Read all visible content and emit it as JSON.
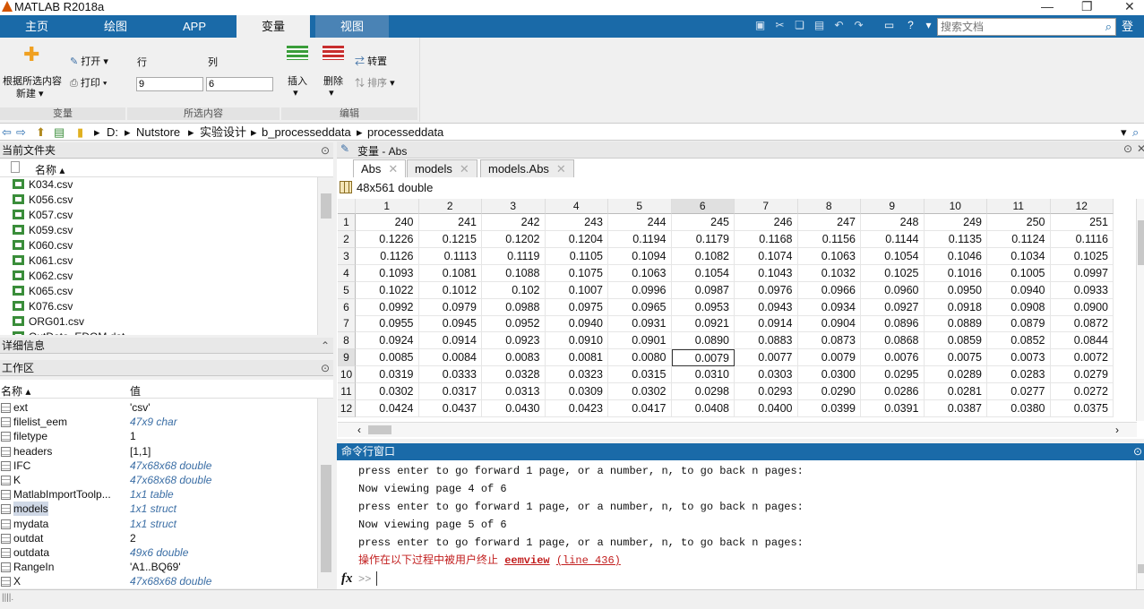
{
  "window": {
    "title": "MATLAB R2018a"
  },
  "tabs": [
    "主页",
    "绘图",
    "APP",
    "变量",
    "视图"
  ],
  "search": {
    "placeholder": "搜索文档"
  },
  "login_label": "登录",
  "ribbon": {
    "new_from_selection": "根据所选内容",
    "new_label": "新建",
    "open_label": "打开",
    "print_label": "打印",
    "rows_label": "行",
    "cols_label": "列",
    "rows_value": "9",
    "cols_value": "6",
    "insert_label": "插入",
    "delete_label": "删除",
    "transpose_label": "转置",
    "sort_label": "排序",
    "section_variable": "变量",
    "section_selection": "所选内容",
    "section_edit": "编辑"
  },
  "address": {
    "segments": [
      "D:",
      "Nutstore",
      "实验设计",
      "b_processeddata",
      "processeddata"
    ]
  },
  "current_folder": {
    "title": "当前文件夹",
    "col_name": "名称",
    "files": [
      "K034.csv",
      "K056.csv",
      "K057.csv",
      "K059.csv",
      "K060.csv",
      "K061.csv",
      "K062.csv",
      "K065.csv",
      "K076.csv",
      "ORG01.csv",
      "OutData_EDOM.dat"
    ]
  },
  "details": {
    "title": "详细信息"
  },
  "workspace": {
    "title": "工作区",
    "col_name": "名称",
    "col_value": "值",
    "vars": [
      {
        "name": "ext",
        "value": "'csv'",
        "italic": false
      },
      {
        "name": "filelist_eem",
        "value": "47x9 char",
        "italic": true
      },
      {
        "name": "filetype",
        "value": "1",
        "italic": false
      },
      {
        "name": "headers",
        "value": "[1,1]",
        "italic": false
      },
      {
        "name": "IFC",
        "value": "47x68x68 double",
        "italic": true
      },
      {
        "name": "K",
        "value": "47x68x68 double",
        "italic": true
      },
      {
        "name": "MatlabImportToolp...",
        "value": "1x1 table",
        "italic": true
      },
      {
        "name": "models",
        "value": "1x1 struct",
        "italic": true
      },
      {
        "name": "mydata",
        "value": "1x1 struct",
        "italic": true
      },
      {
        "name": "outdat",
        "value": "2",
        "italic": false
      },
      {
        "name": "outdata",
        "value": "49x6 double",
        "italic": true
      },
      {
        "name": "RangeIn",
        "value": "'A1..BQ69'",
        "italic": false
      },
      {
        "name": "X",
        "value": "47x68x68 double",
        "italic": true
      }
    ]
  },
  "variable_editor": {
    "title": "变量 - Abs",
    "tabs": [
      "Abs",
      "models",
      "models.Abs"
    ],
    "size_label": "48x561 double",
    "columns": [
      "1",
      "2",
      "3",
      "4",
      "5",
      "6",
      "7",
      "8",
      "9",
      "10",
      "11",
      "12"
    ],
    "rows": [
      [
        "240",
        "241",
        "242",
        "243",
        "244",
        "245",
        "246",
        "247",
        "248",
        "249",
        "250",
        "251"
      ],
      [
        "0.1226",
        "0.1215",
        "0.1202",
        "0.1204",
        "0.1194",
        "0.1179",
        "0.1168",
        "0.1156",
        "0.1144",
        "0.1135",
        "0.1124",
        "0.1116"
      ],
      [
        "0.1126",
        "0.1113",
        "0.1119",
        "0.1105",
        "0.1094",
        "0.1082",
        "0.1074",
        "0.1063",
        "0.1054",
        "0.1046",
        "0.1034",
        "0.1025"
      ],
      [
        "0.1093",
        "0.1081",
        "0.1088",
        "0.1075",
        "0.1063",
        "0.1054",
        "0.1043",
        "0.1032",
        "0.1025",
        "0.1016",
        "0.1005",
        "0.0997"
      ],
      [
        "0.1022",
        "0.1012",
        "0.102",
        "0.1007",
        "0.0996",
        "0.0987",
        "0.0976",
        "0.0966",
        "0.0960",
        "0.0950",
        "0.0940",
        "0.0933"
      ],
      [
        "0.0992",
        "0.0979",
        "0.0988",
        "0.0975",
        "0.0965",
        "0.0953",
        "0.0943",
        "0.0934",
        "0.0927",
        "0.0918",
        "0.0908",
        "0.0900"
      ],
      [
        "0.0955",
        "0.0945",
        "0.0952",
        "0.0940",
        "0.0931",
        "0.0921",
        "0.0914",
        "0.0904",
        "0.0896",
        "0.0889",
        "0.0879",
        "0.0872"
      ],
      [
        "0.0924",
        "0.0914",
        "0.0923",
        "0.0910",
        "0.0901",
        "0.0890",
        "0.0883",
        "0.0873",
        "0.0868",
        "0.0859",
        "0.0852",
        "0.0844"
      ],
      [
        "0.0085",
        "0.0084",
        "0.0083",
        "0.0081",
        "0.0080",
        "0.0079",
        "0.0077",
        "0.0079",
        "0.0076",
        "0.0075",
        "0.0073",
        "0.0072"
      ],
      [
        "0.0319",
        "0.0333",
        "0.0328",
        "0.0323",
        "0.0315",
        "0.0310",
        "0.0303",
        "0.0300",
        "0.0295",
        "0.0289",
        "0.0283",
        "0.0279"
      ],
      [
        "0.0302",
        "0.0317",
        "0.0313",
        "0.0309",
        "0.0302",
        "0.0298",
        "0.0293",
        "0.0290",
        "0.0286",
        "0.0281",
        "0.0277",
        "0.0272"
      ],
      [
        "0.0424",
        "0.0437",
        "0.0430",
        "0.0423",
        "0.0417",
        "0.0408",
        "0.0400",
        "0.0399",
        "0.0391",
        "0.0387",
        "0.0380",
        "0.0375"
      ]
    ],
    "row_labels": [
      "1",
      "2",
      "3",
      "4",
      "5",
      "6",
      "7",
      "8",
      "9",
      "10",
      "11",
      "12"
    ]
  },
  "command_window": {
    "title": "命令行窗口",
    "lines": [
      "press enter to go forward 1 page, or a number, n, to go back n pages:",
      "Now viewing page 4 of 6",
      "press enter to go forward 1 page, or a number, n, to go back n pages:",
      "Now viewing page 5 of 6",
      "press enter to go forward 1 page, or a number, n, to go back n pages:"
    ],
    "error_prefix": "操作在以下过程中被用户终止 ",
    "error_func": "eemview",
    "error_line": "(line 436)",
    "prompt_fx": "fx",
    "prompt": ">>"
  }
}
